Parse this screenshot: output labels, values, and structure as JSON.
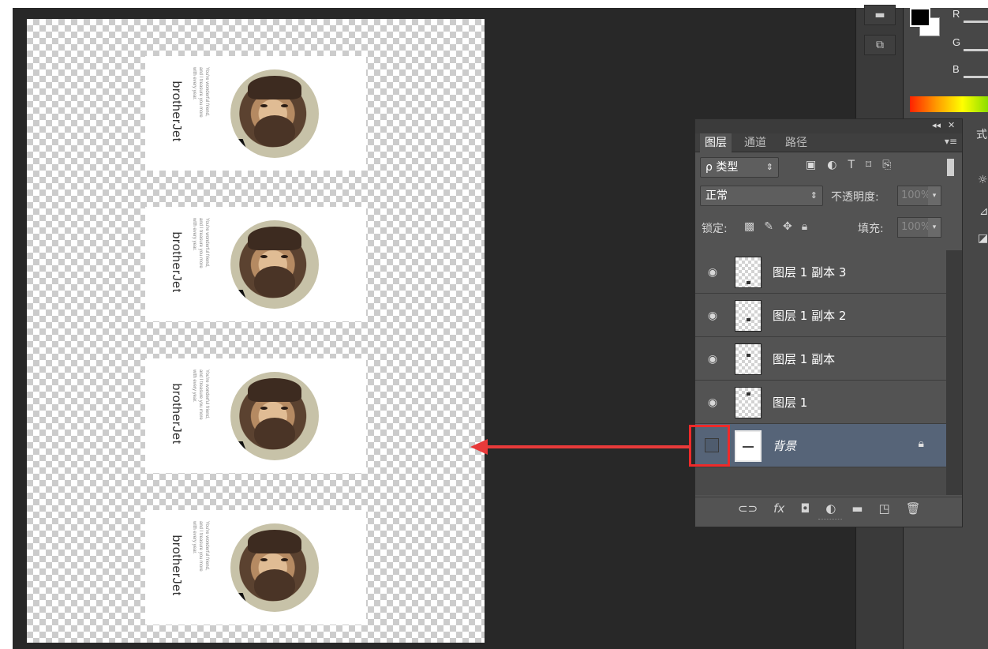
{
  "canvas": {
    "cards": [
      {
        "brand": "brotherJet",
        "tagline": "You're wonderful friend,\nand I treasure you more\nwith every year."
      },
      {
        "brand": "brotherJet",
        "tagline": "You're wonderful friend,\nand I treasure you more\nwith every year."
      },
      {
        "brand": "brotherJet",
        "tagline": "You're wonderful friend,\nand I treasure you more\nwith every year."
      },
      {
        "brand": "brotherJet",
        "tagline": "You're wonderful friend,\nand I treasure you more\nwith every year."
      }
    ]
  },
  "color_panel": {
    "channels": [
      "R",
      "G",
      "B"
    ],
    "side_label": "式"
  },
  "layers_panel": {
    "controls": {
      "collapse": "◂◂",
      "close": "✕"
    },
    "tabs": [
      "图层",
      "通道",
      "路径"
    ],
    "filter": {
      "label": "类型",
      "search_glyph": "ρ"
    },
    "blend_mode": "正常",
    "opacity_label": "不透明度:",
    "opacity_value": "100%",
    "lock_label": "锁定:",
    "fill_label": "填充:",
    "fill_value": "100%",
    "layers": [
      {
        "name": "图层 1 副本 3",
        "visible": true
      },
      {
        "name": "图层 1 副本 2",
        "visible": true
      },
      {
        "name": "图层 1 副本",
        "visible": true
      },
      {
        "name": "图层 1",
        "visible": true
      },
      {
        "name": "背景",
        "visible": false,
        "locked": true,
        "selected": true
      }
    ]
  },
  "colors": {
    "highlight": "#ee2a2a",
    "selected_layer": "#566478",
    "panel_bg": "#535353"
  },
  "icons": {
    "eye": "eye-icon",
    "lock": "lock-icon",
    "link": "link-layers-icon",
    "fx": "fx-icon",
    "mask": "mask-icon",
    "adjust": "adjustment-icon",
    "folder": "group-folder-icon",
    "new": "new-layer-icon",
    "trash": "trash-icon"
  }
}
